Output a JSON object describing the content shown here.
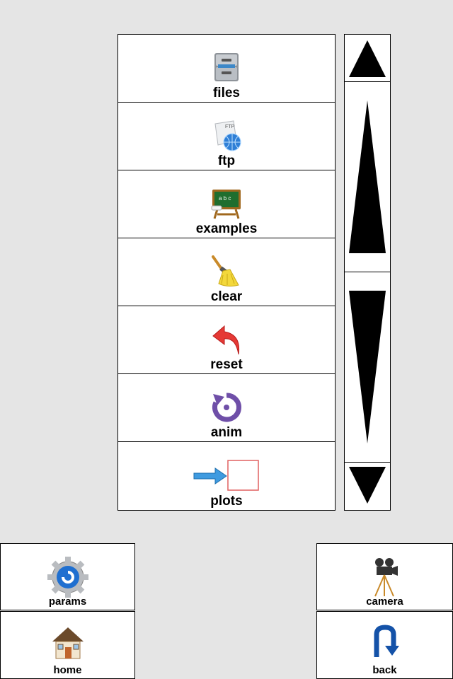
{
  "menu": {
    "items": [
      {
        "label": "files",
        "icon": "file-cabinet-icon"
      },
      {
        "label": "ftp",
        "icon": "ftp-globe-icon"
      },
      {
        "label": "examples",
        "icon": "chalkboard-icon"
      },
      {
        "label": "clear",
        "icon": "broom-icon"
      },
      {
        "label": "reset",
        "icon": "undo-arrow-icon"
      },
      {
        "label": "anim",
        "icon": "rotate-icon"
      },
      {
        "label": "plots",
        "icon": "arrow-to-box-icon"
      }
    ]
  },
  "buttons": {
    "params": "params",
    "camera": "camera",
    "home": "home",
    "back": "back"
  }
}
